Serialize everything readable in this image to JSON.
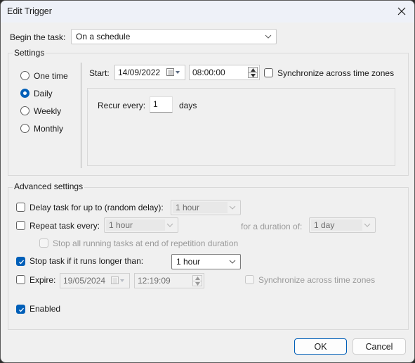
{
  "window": {
    "title": "Edit Trigger"
  },
  "begin": {
    "label": "Begin the task:",
    "value": "On a schedule"
  },
  "settings": {
    "title": "Settings",
    "radios": [
      {
        "label": "One time",
        "selected": false
      },
      {
        "label": "Daily",
        "selected": true
      },
      {
        "label": "Weekly",
        "selected": false
      },
      {
        "label": "Monthly",
        "selected": false
      }
    ],
    "start_label": "Start:",
    "start_date": "14/09/2022",
    "start_time": "08:00:00",
    "sync_label": "Synchronize across time zones",
    "sync_checked": false,
    "recur_label": "Recur every:",
    "recur_value": "1",
    "recur_unit": "days"
  },
  "advanced": {
    "title": "Advanced settings",
    "delay": {
      "label": "Delay task for up to (random delay):",
      "checked": false,
      "value": "1 hour"
    },
    "repeat": {
      "label": "Repeat task every:",
      "checked": false,
      "value": "1 hour",
      "duration_label": "for a duration of:",
      "duration_value": "1 day"
    },
    "stop_all": {
      "label": "Stop all running tasks at end of repetition duration",
      "checked": false
    },
    "stop_long": {
      "label": "Stop task if it runs longer than:",
      "checked": true,
      "value": "1 hour"
    },
    "expire": {
      "label": "Expire:",
      "checked": false,
      "date": "19/05/2024",
      "time": "12:19:09",
      "sync_label": "Synchronize across time zones",
      "sync_checked": false
    },
    "enabled": {
      "label": "Enabled",
      "checked": true
    }
  },
  "buttons": {
    "ok": "OK",
    "cancel": "Cancel"
  },
  "colors": {
    "accent": "#005fb8"
  }
}
